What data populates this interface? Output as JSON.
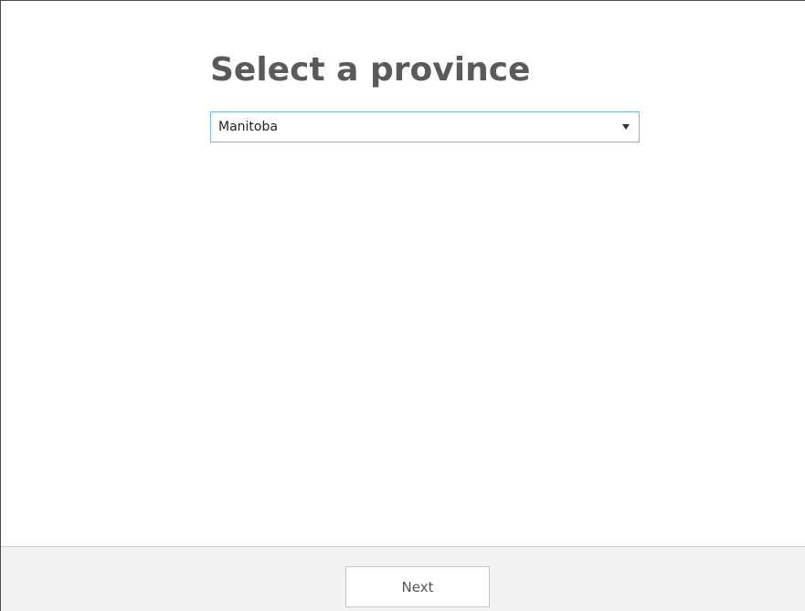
{
  "page": {
    "title": "Select a province"
  },
  "province_select": {
    "selected_value": "Manitoba",
    "arrow_icon": "dropdown-triangle-icon"
  },
  "footer": {
    "next_label": "Next"
  },
  "colors": {
    "title_text": "#5a5a5a",
    "select_border_focus": "#7fb4e6",
    "footer_background": "#f2f2f2",
    "button_border": "#c8c8c8"
  }
}
